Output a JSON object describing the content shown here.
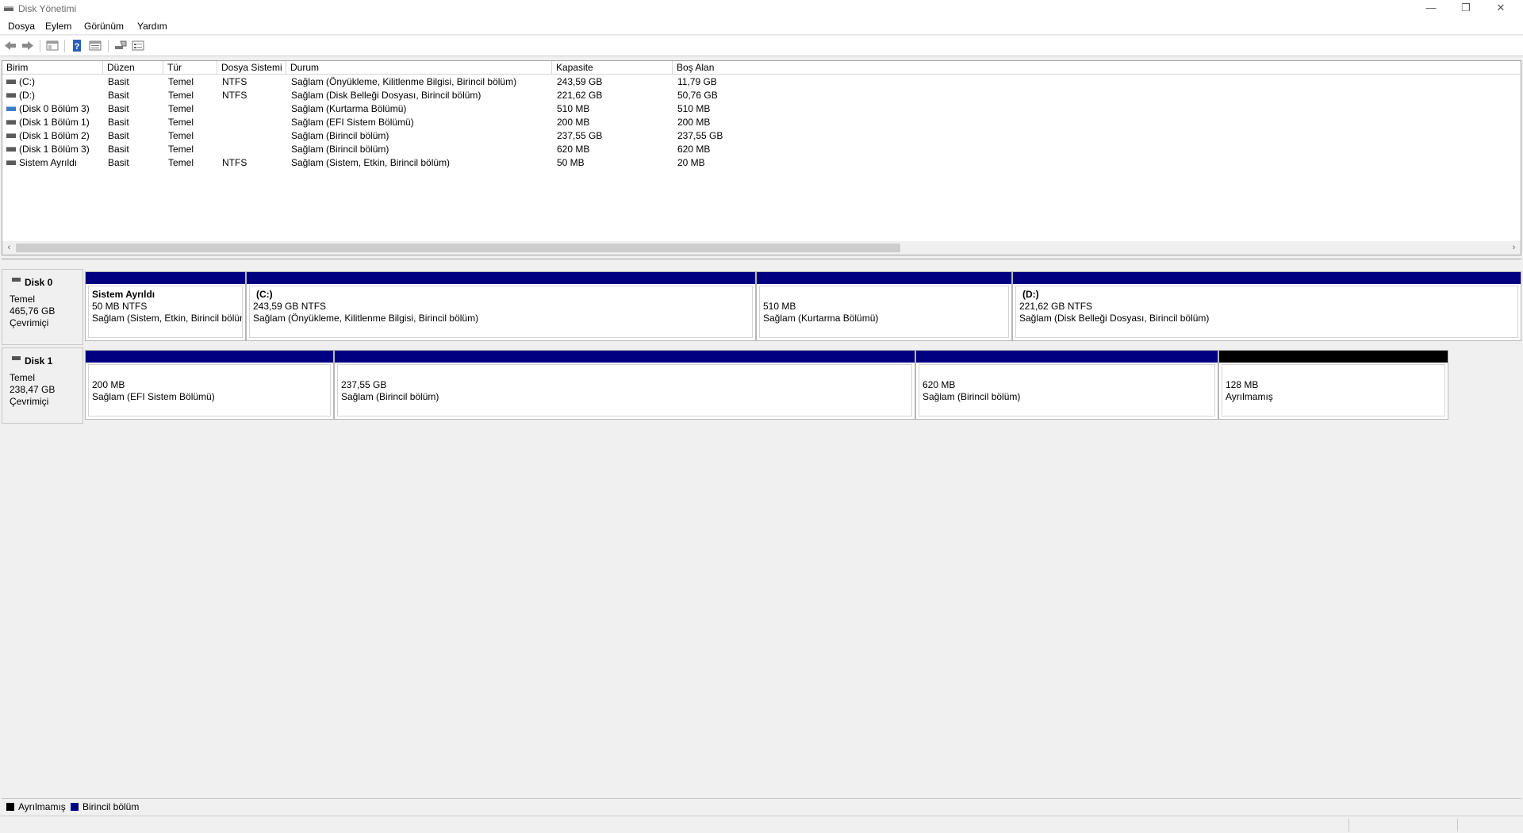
{
  "window": {
    "title": "Disk Yönetimi",
    "minimize_glyph": "—",
    "restore_glyph": "❐",
    "close_glyph": "✕"
  },
  "menu": [
    "Dosya",
    "Eylem",
    "Görünüm",
    "Yardım"
  ],
  "toolbar_icons": [
    "back-icon",
    "forward-icon",
    "show-hide-console-tree-icon",
    "help-icon",
    "properties-icon",
    "disk-list-icon",
    "volume-list-icon"
  ],
  "volume_list": {
    "columns": [
      "Birim",
      "Düzen",
      "Tür",
      "Dosya Sistemi",
      "Durum",
      "Kapasite",
      "Boş Alan"
    ],
    "rows": [
      {
        "name": "(C:)",
        "layout": "Basit",
        "type": "Temel",
        "fs": "NTFS",
        "status": "Sağlam (Önyükleme, Kilitlenme Bilgisi, Birincil bölüm)",
        "capacity": "243,59 GB",
        "free": "11,79 GB",
        "icon_color": "gray"
      },
      {
        "name": "(D:)",
        "layout": "Basit",
        "type": "Temel",
        "fs": "NTFS",
        "status": "Sağlam (Disk Belleği Dosyası, Birincil bölüm)",
        "capacity": "221,62 GB",
        "free": "50,76 GB",
        "icon_color": "gray"
      },
      {
        "name": "(Disk 0 Bölüm 3)",
        "layout": "Basit",
        "type": "Temel",
        "fs": "",
        "status": "Sağlam (Kurtarma Bölümü)",
        "capacity": "510 MB",
        "free": "510 MB",
        "icon_color": "blue"
      },
      {
        "name": "(Disk 1 Bölüm 1)",
        "layout": "Basit",
        "type": "Temel",
        "fs": "",
        "status": "Sağlam (EFI Sistem Bölümü)",
        "capacity": "200 MB",
        "free": "200 MB",
        "icon_color": "gray"
      },
      {
        "name": "(Disk 1 Bölüm 2)",
        "layout": "Basit",
        "type": "Temel",
        "fs": "",
        "status": "Sağlam (Birincil bölüm)",
        "capacity": "237,55 GB",
        "free": "237,55 GB",
        "icon_color": "gray"
      },
      {
        "name": "(Disk 1 Bölüm 3)",
        "layout": "Basit",
        "type": "Temel",
        "fs": "",
        "status": "Sağlam (Birincil bölüm)",
        "capacity": "620 MB",
        "free": "620 MB",
        "icon_color": "gray"
      },
      {
        "name": "Sistem Ayrıldı",
        "layout": "Basit",
        "type": "Temel",
        "fs": "NTFS",
        "status": "Sağlam (Sistem, Etkin, Birincil bölüm)",
        "capacity": "50 MB",
        "free": "20 MB",
        "icon_color": "gray"
      }
    ]
  },
  "disks": [
    {
      "name": "Disk 0",
      "type": "Temel",
      "size": "465,76 GB",
      "state": "Çevrimiçi",
      "partitions": [
        {
          "title": "Sistem Ayrıldı",
          "line1": "50 MB NTFS",
          "line2": "Sağlam (Sistem, Etkin, Birincil bölüm)",
          "bar": "primary"
        },
        {
          "title": "(C:)",
          "line1": "243,59 GB NTFS",
          "line2": "Sağlam (Önyükleme, Kilitlenme Bilgisi, Birincil bölüm)",
          "bar": "primary"
        },
        {
          "title": "",
          "line1": "510 MB",
          "line2": "Sağlam (Kurtarma Bölümü)",
          "bar": "primary"
        },
        {
          "title": "(D:)",
          "line1": "221,62 GB NTFS",
          "line2": "Sağlam (Disk Belleği Dosyası, Birincil bölüm)",
          "bar": "primary"
        }
      ]
    },
    {
      "name": "Disk 1",
      "type": "Temel",
      "size": "238,47 GB",
      "state": "Çevrimiçi",
      "partitions": [
        {
          "title": "",
          "line1": "200 MB",
          "line2": "Sağlam (EFI Sistem Bölümü)",
          "bar": "primary"
        },
        {
          "title": "",
          "line1": "237,55 GB",
          "line2": "Sağlam (Birincil bölüm)",
          "bar": "primary"
        },
        {
          "title": "",
          "line1": "620 MB",
          "line2": "Sağlam (Birincil bölüm)",
          "bar": "primary"
        },
        {
          "title": "",
          "line1": "128 MB",
          "line2": "Ayrılmamış",
          "bar": "unallocated"
        }
      ]
    }
  ],
  "legend": [
    {
      "label": "Ayrılmamış",
      "color": "#000000"
    },
    {
      "label": "Birincil bölüm",
      "color": "#000080"
    }
  ],
  "colors": {
    "primary": "#000080",
    "unallocated": "#000000"
  }
}
